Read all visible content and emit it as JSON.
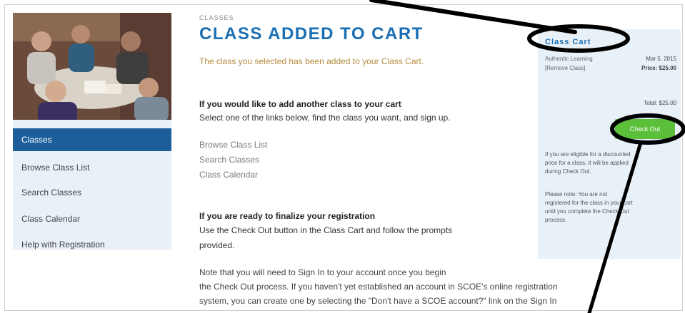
{
  "sidebar": {
    "active_label": "Classes",
    "items": [
      {
        "label": "Browse Class List"
      },
      {
        "label": "Search Classes"
      },
      {
        "label": "Class Calendar"
      },
      {
        "label": "Help with Registration"
      }
    ]
  },
  "breadcrumb": "CLASSES",
  "page_title": "CLASS ADDED TO CART",
  "subtitle": "The class you selected has been added to your Class Cart.",
  "add_another": {
    "heading": "If you would like to add another class to your cart",
    "text": "Select one of the links below, find the class you want, and sign up.",
    "links": [
      "Browse Class List",
      "Search Classes",
      "Class Calendar"
    ]
  },
  "finalize": {
    "heading": "If you are ready to finalize your registration",
    "text1": "Use the Check Out button in the Class Cart and follow the prompts",
    "text2": "provided."
  },
  "note": {
    "line1": "Note that you will need to Sign In to your account once you begin",
    "line2": "the Check Out process. If you haven't yet established an account in SCOE's online registration",
    "line3": "system, you can create one by selecting the \"Don't have a SCOE account?\" link on the Sign In"
  },
  "cart": {
    "title": "Class Cart",
    "item_name": "Authentic Learning",
    "item_date": "Mar 5, 2015",
    "remove_label": "[Remove Class]",
    "price": "Price: $25.00",
    "total": "Total: $25.00",
    "checkout_label": "Check Out",
    "note1_l1": "If you are eligible for a discounted",
    "note1_l2": "price for a class, it will be applied",
    "note1_l3": "during Check Out.",
    "note2_l1": "Please note: You are not",
    "note2_l2": "registered for the class in your cart",
    "note2_l3": "until you complete the Check Out",
    "note2_l4": "process."
  },
  "colors": {
    "accent_blue": "#1a6fb4",
    "nav_active": "#1b5e9a",
    "checkout_green": "#5cbf3a",
    "panel_bg": "#e9f1f8"
  }
}
